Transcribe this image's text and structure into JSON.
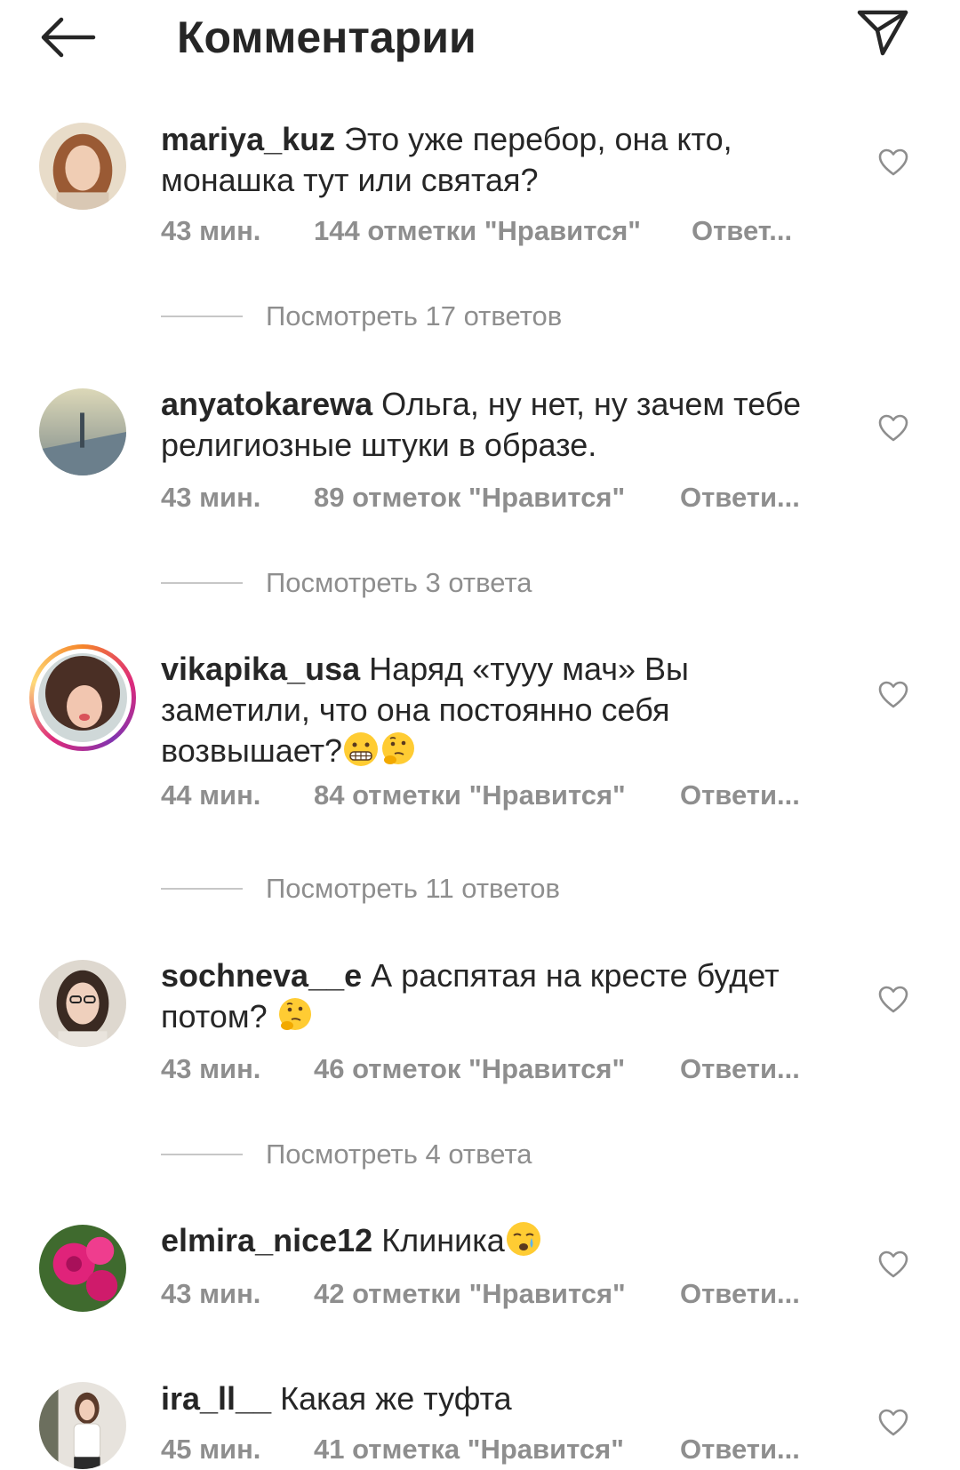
{
  "header": {
    "title": "Комментарии",
    "back_icon": "arrow-left-icon",
    "share_icon": "paper-plane-icon"
  },
  "comments": [
    {
      "username": "mariya_kuz",
      "text": "Это уже перебор, она кто, монашка тут или святая?",
      "emoji": [],
      "time": "43 мин.",
      "likes": "144 отметки \"Нравится\"",
      "reply": "Ответ...",
      "view_replies": "Посмотреть 17 ответов",
      "avatar_color": "#b07a56"
    },
    {
      "username": "anyatokarewa",
      "text": "Ольга, ну нет, ну зачем тебе религиозные штуки в образе.",
      "emoji": [],
      "time": "43 мин.",
      "likes": "89 отметок \"Нравится\"",
      "reply": "Ответи...",
      "view_replies": "Посмотреть 3 ответа",
      "avatar_color": "#9aa59a"
    },
    {
      "username": "vikapika_usa",
      "text": "Наряд «тууу мач» Вы заметили, что она постоянно себя возвышает?",
      "emoji": [
        "grimacing-face-emoji",
        "thinking-face-emoji"
      ],
      "time": "44 мин.",
      "likes": "84 отметки \"Нравится\"",
      "reply": "Ответи...",
      "view_replies": "Посмотреть 11 ответов",
      "avatar_color": "#6b4a3a"
    },
    {
      "username": "sochneva__e",
      "text": "А распятая на кресте будет потом?",
      "emoji": [
        "thinking-face-emoji"
      ],
      "time": "43 мин.",
      "likes": "46 отметок \"Нравится\"",
      "reply": "Ответи...",
      "view_replies": "Посмотреть 4 ответа",
      "avatar_color": "#c9c1b8"
    },
    {
      "username": "elmira_nice12",
      "text": "Клиника",
      "emoji": [
        "crying-face-emoji"
      ],
      "time": "43 мин.",
      "likes": "42 отметки \"Нравится\"",
      "reply": "Ответи...",
      "view_replies": "",
      "avatar_color": "#d8257a"
    },
    {
      "username": "ira_ll__",
      "text": "Какая же туфта",
      "emoji": [],
      "time": "45 мин.",
      "likes": "41 отметка \"Нравится\"",
      "reply": "Ответи...",
      "view_replies": "",
      "avatar_color": "#d7d2cc"
    }
  ],
  "icons": {
    "heart": "heart-outline-icon"
  },
  "colors": {
    "text": "#262626",
    "muted": "#8e8e8e",
    "divider": "#c7c7c7"
  }
}
